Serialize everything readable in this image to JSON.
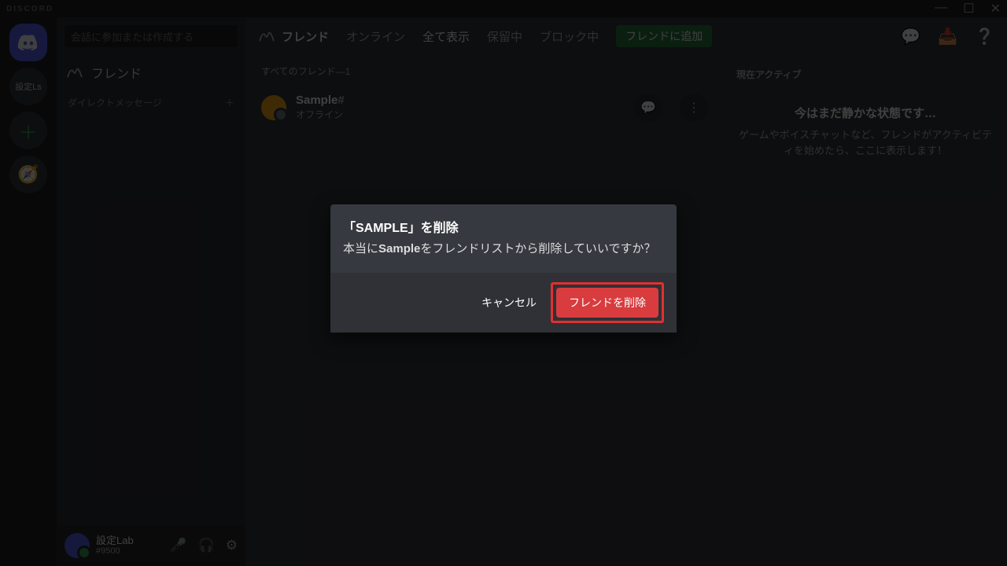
{
  "titlebar": {
    "logo": "DISCORD"
  },
  "rail": {
    "server_label": "設定Ls"
  },
  "sidebar": {
    "search_placeholder": "会話に参加または作成する",
    "friends_label": "フレンド",
    "dm_label": "ダイレクトメッセージ"
  },
  "userbar": {
    "name": "設定Lab",
    "id": "#9500"
  },
  "topbar": {
    "title": "フレンド",
    "tab_online": "オンライン",
    "tab_all": "全て表示",
    "tab_pending": "保留中",
    "tab_blocked": "ブロック中",
    "add_friend": "フレンドに追加"
  },
  "friendlist": {
    "header": "すべてのフレンド—1",
    "rows": [
      {
        "name": "Sample",
        "status": "オフライン"
      }
    ]
  },
  "rightpanel": {
    "title": "現在アクティブ",
    "quiet_title": "今はまだ静かな状態です…",
    "quiet_body": "ゲームやボイスチャットなど、フレンドがアクティビティを始めたら、ここに表示します！"
  },
  "modal": {
    "title": "「SAMPLE」を削除",
    "body_pre": "本当に",
    "body_name": "Sample",
    "body_post": "をフレンドリストから削除していいですか？",
    "cancel": "キャンセル",
    "confirm": "フレンドを削除"
  }
}
